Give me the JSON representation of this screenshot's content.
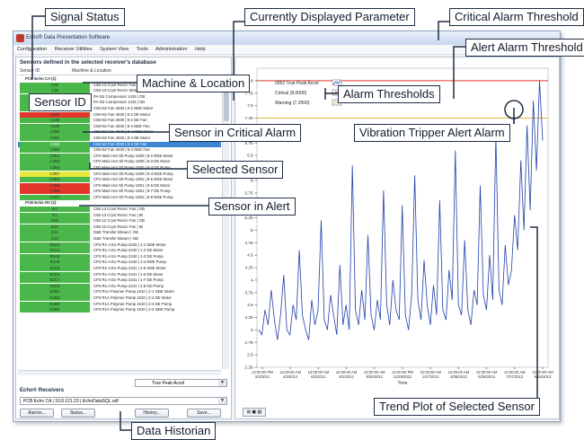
{
  "window": {
    "title": "Echo® Data Presentation Software",
    "menu": [
      "Configuration",
      "Receiver Utilities",
      "System View",
      "Tools",
      "Administration",
      "Help"
    ]
  },
  "left_panel": {
    "title": "Sensors defined in the selected receiver's database",
    "col_sensor_id": "Sensor ID",
    "col_location": "Machine & Location",
    "groups": [
      {
        "label": "PCB Echo CA (1)",
        "rows": [
          {
            "id": "C08",
            "status": "green",
            "loc": "C55-13 Cryst Recirc Fan | OB"
          },
          {
            "id": "C1B",
            "status": "green",
            "loc": "C55-13 Cryst Recirc Motor | NDE"
          },
          {
            "id": "C44",
            "status": "green",
            "loc": "PA-N2 Compressor 1415 | OB"
          },
          {
            "id": "C45",
            "status": "green",
            "loc": "PA-N2 Compressor 1415 | ND"
          },
          {
            "id": "C346",
            "status": "green",
            "loc": "C55-N2 Fan 4030 | 8-2 NDE Motor"
          },
          {
            "id": "C347",
            "status": "red",
            "loc": "C55-N2 Fan 4030 | 8-2 DE Motor"
          },
          {
            "id": "C348",
            "status": "green",
            "loc": "C55-N2 Fan 4030 | 8-2 DE Fan"
          },
          {
            "id": "C349",
            "status": "green",
            "loc": "C55-N2 Fan 4030 | 8-4 NDE Fan"
          },
          {
            "id": "C350",
            "status": "green",
            "loc": "C55-N2 Fan 4040 | 8-4 NDE Motor"
          },
          {
            "id": "C351",
            "status": "green",
            "loc": "C55-N2 Fan 4040 | 8-4 DE Motor"
          },
          {
            "id": "C352",
            "status": "green",
            "loc": "C55-N2 Fan 4040 | 8-2 DE Fan",
            "selected": true
          },
          {
            "id": "C353",
            "status": "green",
            "loc": "C55-N2 Fan 4040 | 8-4 NDE Fan"
          },
          {
            "id": "C3N1",
            "status": "green",
            "loc": "CP2 Main Hot Oil Pump 1600 | 8-1 NDE Motor"
          },
          {
            "id": "C3N2",
            "status": "green",
            "loc": "CP2 Main Hot Oil Pump 1600 | 8-2 DE Motor"
          },
          {
            "id": "C3N3",
            "status": "green",
            "loc": "CP2 Main Hot Oil Pump 1600 | 8-3 DE Pump"
          },
          {
            "id": "C3N7",
            "status": "yellow",
            "loc": "CP2 Main Hot Oil Pump 1600 | 8-4 NDE Pump"
          },
          {
            "id": "C4N4",
            "status": "green",
            "loc": "CP2 Main Hot Oil Pump 1601 | 8-5 NDE Motor"
          },
          {
            "id": "C4N5",
            "status": "red",
            "loc": "CP2 Main Hot Oil Pump 1601 | 8-6 DE Motor"
          },
          {
            "id": "C4N6",
            "status": "red",
            "loc": "CP2 Main Hot Oil Pump 1601 | 8-7 DE Pump"
          },
          {
            "id": "C4N7",
            "status": "green",
            "loc": "CP2 Main Hot Oil Pump 1601 | 8-8 NDE Pump"
          }
        ]
      },
      {
        "label": "PCB Echo NV (2)",
        "rows": [
          {
            "id": "E1",
            "status": "green",
            "loc": "C55-13 Cryst Recirc Fan | OB"
          },
          {
            "id": "E7",
            "status": "green",
            "loc": "C55-13 Cryst Recirc Fan | IB"
          },
          {
            "id": "E09",
            "status": "green",
            "loc": "C55-12 Cryst Recirc Fan | OB"
          },
          {
            "id": "E10",
            "status": "green",
            "loc": "C55-12 Cryst Recirc Fan | IB"
          },
          {
            "id": "E11",
            "status": "green",
            "loc": "D&E Transfer Blower | OB"
          },
          {
            "id": "E13",
            "status": "green",
            "loc": "D&E Transfer Blower | ND"
          },
          {
            "id": "E2A3",
            "status": "green",
            "loc": "CP3 R1-A Ex Pump 2240 | 1-1 NDE Motor"
          },
          {
            "id": "E2A4",
            "status": "green",
            "loc": "CP3 R1-A Ex Pump 2240 | 1-2 DE Motor"
          },
          {
            "id": "E2A5",
            "status": "green",
            "loc": "CP3 R1-A Ex Pump 2240 | 1-3 DE Pump"
          },
          {
            "id": "E2A6",
            "status": "green",
            "loc": "CP3 R1-A Ex Pump 2240 | 1-4 NDE Pump"
          },
          {
            "id": "E2C5",
            "status": "green",
            "loc": "CP3 R1-A Ex Pump 2241 | 1-5 NDE Motor"
          },
          {
            "id": "E2C6",
            "status": "green",
            "loc": "CP3 R1-A Ex Pump 2241 | 1-6 DE Motor"
          },
          {
            "id": "E2C7",
            "status": "green",
            "loc": "CP3 R1-A Ex Pump 2241 | 1-7 DE Pump"
          },
          {
            "id": "E2C8",
            "status": "green",
            "loc": "CP3 R1-A Ex Pump 2241 | 1-8 ND Pump"
          },
          {
            "id": "E2M1",
            "status": "green",
            "loc": "CP3 R1A Polymer Pump 1010 | 2-1 NDE Motor"
          },
          {
            "id": "E2M2",
            "status": "green",
            "loc": "CP3 R1A Polymer Pump 1010 | 2-2 DE Motor"
          },
          {
            "id": "E2M3",
            "status": "green",
            "loc": "CP3 R1A Polymer Pump 1010 | 2-3 DE Pump"
          },
          {
            "id": "E2M4",
            "status": "green",
            "loc": "CP3 R1A Polymer Pump 1010 | 2-4 NDE Pump"
          }
        ]
      }
    ],
    "parameter_select": "True Peak Accel",
    "receivers_title": "Echo® Receivers",
    "receiver_select": "PCB Echo CA | 10.8.121.23 | EchoDataSQL.sdf",
    "buttons": [
      "Alarms...",
      "Status...",
      "History...",
      "Save..."
    ]
  },
  "chart": {
    "toolbar": "⊞ ▣ ▤",
    "colors": {
      "green": "#49b74a",
      "red": "#e2362b",
      "yellow": "#e8e83a",
      "line": "#2040a8",
      "critical": "#e2362b",
      "warning": "#e8b23a"
    }
  },
  "chart_data": {
    "type": "line",
    "title": "",
    "xlabel": "Time",
    "ylabel": "",
    "ylim": [
      2.25,
      8.25
    ],
    "yticks": [
      "8-",
      "7.75-",
      "7.5-",
      "7.25-",
      "7-",
      "6.75-",
      "6.5-",
      "6.25-",
      "6-",
      "5.75-",
      "5.5-",
      "5.25-",
      "5-",
      "4.75-",
      "4.5-",
      "4.25-",
      "4-",
      "3.75-",
      "3.5-",
      "3.25-",
      "3-",
      "2.75-",
      "2.5-",
      "2.25-"
    ],
    "xticks": [
      {
        "time": "12:00:00 PM",
        "date": "2/3/2012"
      },
      {
        "time": "12:00:00 AM",
        "date": "4/3/2012"
      },
      {
        "time": "12:00:00 AM",
        "date": "6/2/2012"
      },
      {
        "time": "12:00:00 AM",
        "date": "8/1/2012"
      },
      {
        "time": "12:00:00 AM",
        "date": "9/30/2012"
      },
      {
        "time": "12:00:00 PM",
        "date": "11/29/2012"
      },
      {
        "time": "12:00:00 AM",
        "date": "1/27/2013"
      },
      {
        "time": "12:00:00 AM",
        "date": "3/28/2013"
      },
      {
        "time": "12:00:00 AM",
        "date": "5/28/2013"
      },
      {
        "time": "12:00:00 AM",
        "date": "7/27/2013"
      },
      {
        "time": "12:00:00 AM",
        "date": "9/25/2013"
      }
    ],
    "legend": [
      {
        "label": "0052 True Peak Accel",
        "color": "#2040a8"
      },
      {
        "label": "Critical (8.0000)",
        "color": "#e2362b"
      },
      {
        "label": "Warning (7.2500)",
        "color": "#e8b23a"
      }
    ],
    "critical_threshold": 8.0,
    "warning_threshold": 7.25,
    "series": [
      {
        "name": "0052 True Peak Accel",
        "values": [
          3.0,
          2.9,
          3.4,
          3.1,
          3.8,
          3.2,
          2.8,
          3.3,
          4.1,
          3.0,
          2.9,
          3.5,
          3.2,
          4.6,
          3.3,
          3.0,
          2.8,
          3.6,
          3.1,
          3.4,
          5.2,
          3.2,
          3.0,
          3.7,
          3.3,
          2.9,
          4.3,
          3.1,
          3.5,
          3.0,
          6.3,
          3.4,
          3.1,
          3.8,
          3.2,
          4.9,
          3.3,
          3.0,
          3.6,
          3.2,
          5.8,
          3.5,
          3.1,
          4.0,
          3.4,
          3.2,
          5.5,
          3.3,
          3.0,
          3.7,
          6.1,
          3.6,
          3.2,
          4.4,
          3.5,
          3.1,
          3.9,
          3.3,
          5.6,
          3.4,
          3.2,
          4.2,
          3.6,
          6.6,
          3.5,
          3.3,
          4.8,
          3.4,
          3.1,
          3.8,
          3.5,
          5.9,
          3.7,
          3.4,
          4.5,
          3.6,
          6.9,
          3.8,
          3.5,
          4.7,
          3.9,
          4.2,
          5.3,
          4.6,
          6.4,
          5.0,
          7.1,
          5.4,
          7.6,
          6.2,
          8.0,
          6.8
        ]
      }
    ]
  },
  "callouts": {
    "signal_status": "Signal Status",
    "currently_displayed": "Currently Displayed Parameter",
    "critical_alarm_threshold": "Critical Alarm Threshold",
    "alert_alarm_threshold": "Alert Alarm Threshold",
    "machine_location": "Machine & Location",
    "sensor_id": "Sensor ID",
    "alarm_thresholds": "Alarm Thresholds",
    "sensor_critical": "Sensor in Critical Alarm",
    "vibration_tripper": "Vibration Tripper Alert Alarm",
    "selected_sensor": "Selected Sensor",
    "sensor_alert": "Sensor in Alert",
    "trend_plot": "Trend Plot of Selected Sensor",
    "data_historian": "Data Historian"
  }
}
